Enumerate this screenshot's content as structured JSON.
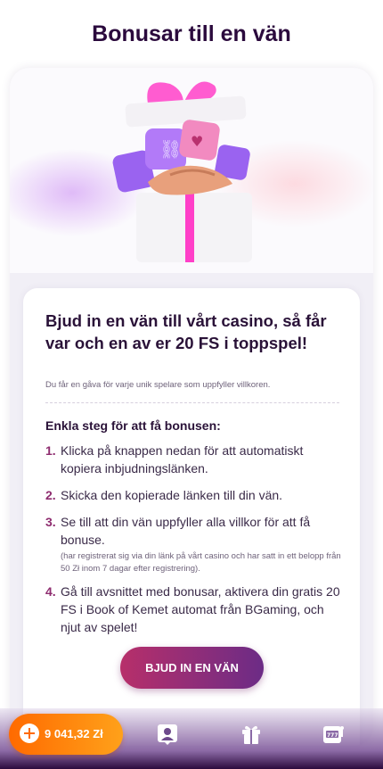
{
  "page": {
    "title": "Bonusar till en vän"
  },
  "card": {
    "headline": "Bjud in en vän till vårt casino, så får var och en av er 20 FS i toppspel!",
    "subline": "Du får en gåva för varje unik spelare som uppfyller villkoren.",
    "steps_title": "Enkla steg för att få bonusen:",
    "steps": [
      {
        "num": "1.",
        "text": "Klicka på knappen nedan för att automatiskt kopiera inbjudningslänken."
      },
      {
        "num": "2.",
        "text": "Skicka den kopierade länken till din vän."
      },
      {
        "num": "3.",
        "text": "Se till att din vän uppfyller alla villkor för att få bonuse.",
        "note": "(har registrerat sig via din länk på vårt casino och har satt in ett belopp från 50 Zł inom 7 dagar efter registrering)."
      },
      {
        "num": "4.",
        "text": "Gå till avsnittet med bonusar, aktivera din gratis 20 FS i Book of Kemet automat från BGaming, och njut av spelet!"
      }
    ],
    "cta_label": "BJUD IN EN VÄN"
  },
  "bottom_nav": {
    "balance": "9 041,32 Zł",
    "items": [
      {
        "icon": "profile-icon"
      },
      {
        "icon": "gift-icon"
      },
      {
        "icon": "slot-machine-icon"
      }
    ]
  },
  "colors": {
    "title": "#2b0a3d",
    "accent": "#8e2c6f",
    "cta_start": "#b72f6a",
    "cta_end": "#6c2c86",
    "balance_start": "#ff6a00",
    "balance_end": "#ffa11a"
  }
}
